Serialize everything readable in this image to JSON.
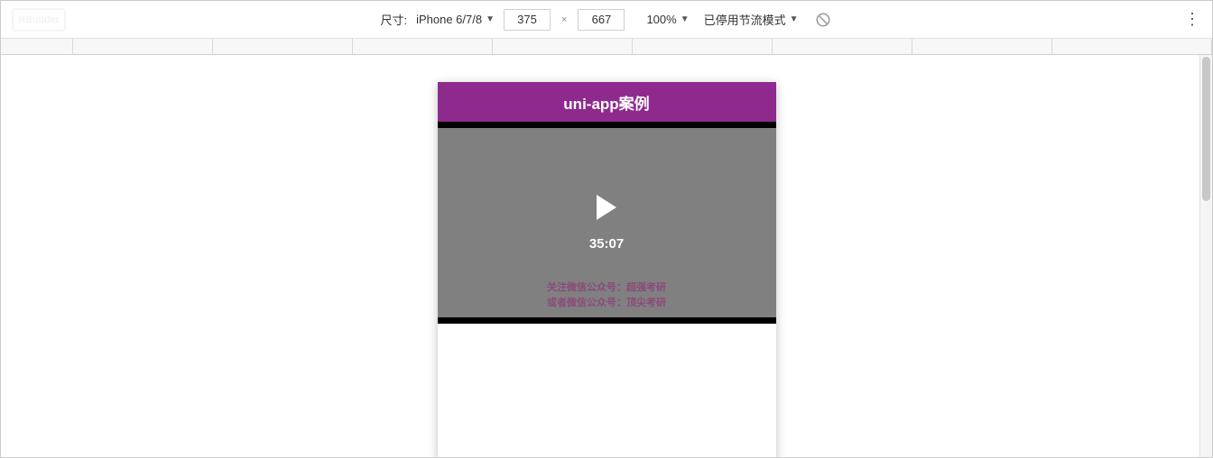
{
  "toolbar": {
    "size_label": "尺寸:",
    "device_name": "iPhone 6/7/8",
    "width": "375",
    "height": "667",
    "zoom": "100%",
    "throttle": "已停用节流模式"
  },
  "watermark": "HBuilder",
  "app": {
    "title": "uni-app案例",
    "video": {
      "duration": "35:07",
      "caption_line1": "关注微信公众号：超强考研",
      "caption_line2": "或者微信公众号：顶尖考研"
    }
  }
}
